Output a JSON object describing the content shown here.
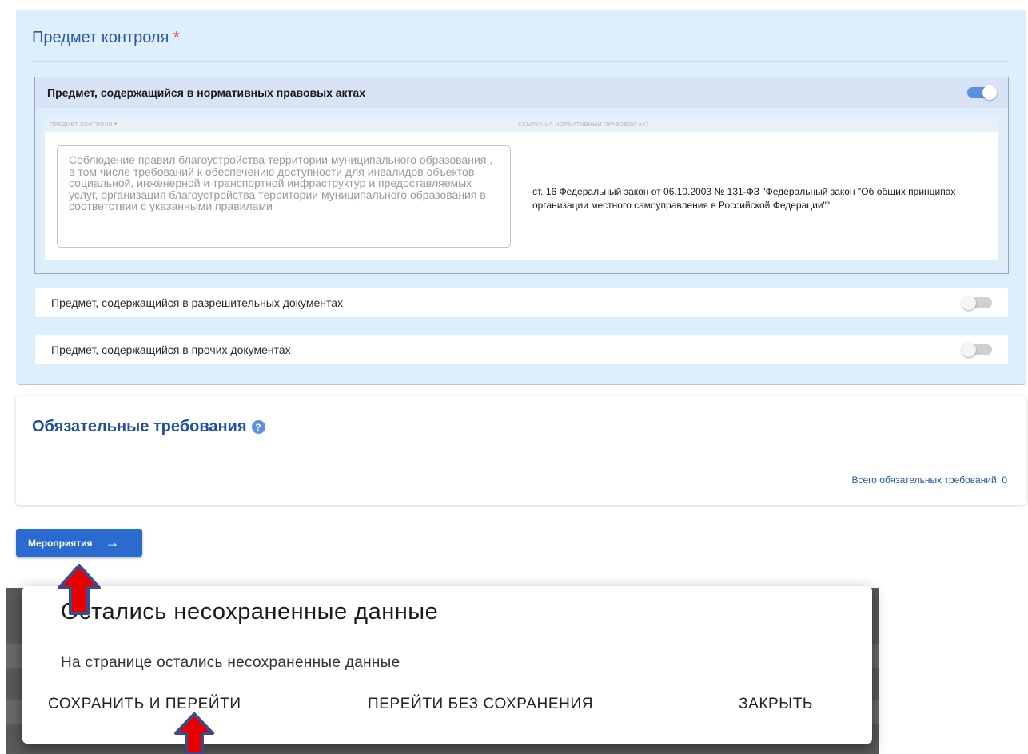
{
  "control_subject": {
    "title": "Предмет контроля",
    "required_mark": "*",
    "npa_block": {
      "header": "Предмет, содержащийся в нормативных правовых актах",
      "toggle_on": true,
      "columns": {
        "subject": "ПРЕДМЕТ КОНТРОЛЯ",
        "subject_required": "*",
        "act_link": "ССЫЛКА НА НОРМАТИВНЫЙ ПРАВОВОЙ АКТ"
      },
      "subject_text": "Соблюдение правил благоустройства территории муниципального образования , в том числе требований к обеспечению доступности для инвалидов объектов социальной, инженерной и транспортной инфраструктур и предоставляемых услуг, организация благоустройства территории муниципального образования в соответствии с указанными правилами",
      "act_link": "ст. 16 Федеральный закон от 06.10.2003 № 131-ФЗ \"Федеральный закон \"Об общих принципах организации местного самоуправления в Российской Федерации\"\""
    },
    "permit_docs": {
      "label": "Предмет, содержащийся в разрешительных документах",
      "toggle_on": false
    },
    "other_docs": {
      "label": "Предмет, содержащийся в прочих документах",
      "toggle_on": false
    }
  },
  "requirements": {
    "title": "Обязательные требования",
    "help_icon": "question-circle-icon",
    "total": "Всего обязательных требований: 0"
  },
  "events_button": {
    "label": "Мероприятия",
    "icon": "arrow-right-icon"
  },
  "dialog": {
    "title": "Остались несохраненные данные",
    "message": "На странице остались несохраненные данные",
    "buttons": {
      "save_and_go": "СОХРАНИТЬ И ПЕРЕЙТИ",
      "go_without_save": "ПЕРЕЙТИ БЕЗ СОХРАНЕНИЯ",
      "close": "ЗАКРЫТЬ"
    }
  },
  "colors": {
    "accent": "#2a6bd0",
    "section_bg": "#ddeefd",
    "required": "#e53935",
    "annotation_arrow_fill": "#e80000",
    "annotation_arrow_outline": "#3b4a8c"
  }
}
